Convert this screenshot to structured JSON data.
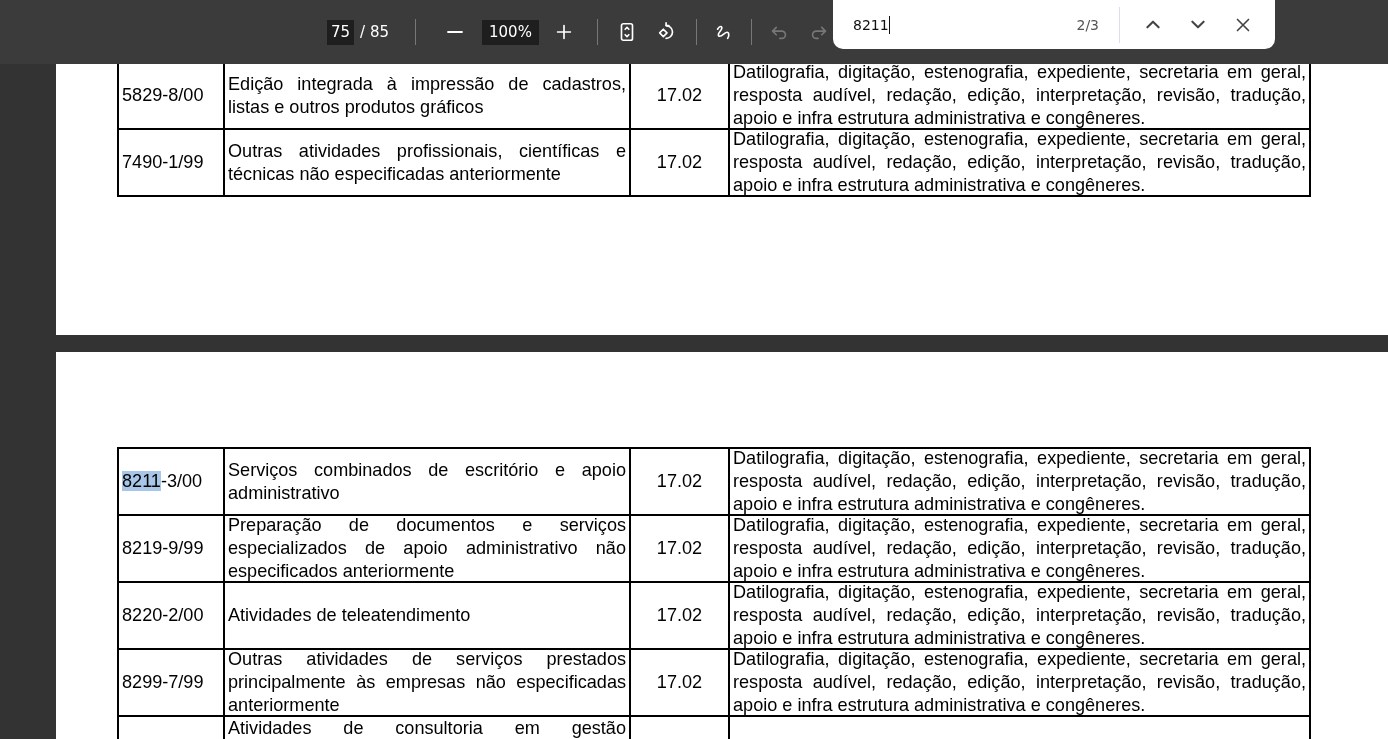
{
  "toolbar": {
    "page": "75",
    "page_total": "/ 85",
    "zoom": "100%",
    "undo": {
      "disabled": true
    },
    "redo": {
      "disabled": true
    }
  },
  "find_bar": {
    "query": "8211",
    "count": "2/3"
  },
  "pages": [
    {
      "kind": "cut_top",
      "rows": [
        {
          "code": "5829-8/00",
          "description": "Edição integrada à impressão de cadastros, listas e outros produtos gráficos",
          "item": "17.02",
          "service": "Datilografia, digitação, estenografia, expediente, secretaria em geral, resposta audível, redação, edição, interpretação, revisão, tradução, apoio e infra estrutura administrativa e congêneres."
        },
        {
          "code": "7490-1/99",
          "description": "Outras atividades profissionais, científicas e técnicas não especificadas anteriormente",
          "item": "17.02",
          "service": "Datilografia, digitação, estenografia, expediente, secretaria em geral, resposta audível, redação, edição, interpretação, revisão, tradução, apoio e infra estrutura administrativa e congêneres."
        }
      ]
    },
    {
      "kind": "cut_bottom",
      "rows": [
        {
          "code_match": "8211",
          "code": "-3/00",
          "description": "Serviços combinados de escritório e apoio administrativo",
          "item": "17.02",
          "service": "Datilografia, digitação, estenografia, expediente, secretaria em geral, resposta audível, redação, edição, interpretação, revisão, tradução, apoio e infra estrutura administrativa e congêneres."
        },
        {
          "code": "8219-9/99",
          "description": "Preparação de documentos e serviços especializados de apoio administrativo não especificados anteriormente",
          "item": "17.02",
          "service": "Datilografia, digitação, estenografia, expediente, secretaria em geral, resposta audível, redação, edição, interpretação, revisão, tradução, apoio e infra estrutura administrativa e congêneres."
        },
        {
          "code": "8220-2/00",
          "description": "Atividades de teleatendimento",
          "item": "17.02",
          "service": "Datilografia, digitação, estenografia, expediente, secretaria em geral, resposta audível, redação, edição, interpretação, revisão, tradução, apoio e infra estrutura administrativa e congêneres."
        },
        {
          "code": "8299-7/99",
          "description": "Outras atividades de serviços prestados principalmente às empresas não especificadas anteriormente",
          "item": "17.02",
          "service": "Datilografia, digitação, estenografia, expediente, secretaria em geral, resposta audível, redação, edição, interpretação, revisão, tradução, apoio e infra estrutura administrativa e congêneres."
        },
        {
          "description": "Atividades de consultoria em gestão"
        }
      ]
    }
  ]
}
